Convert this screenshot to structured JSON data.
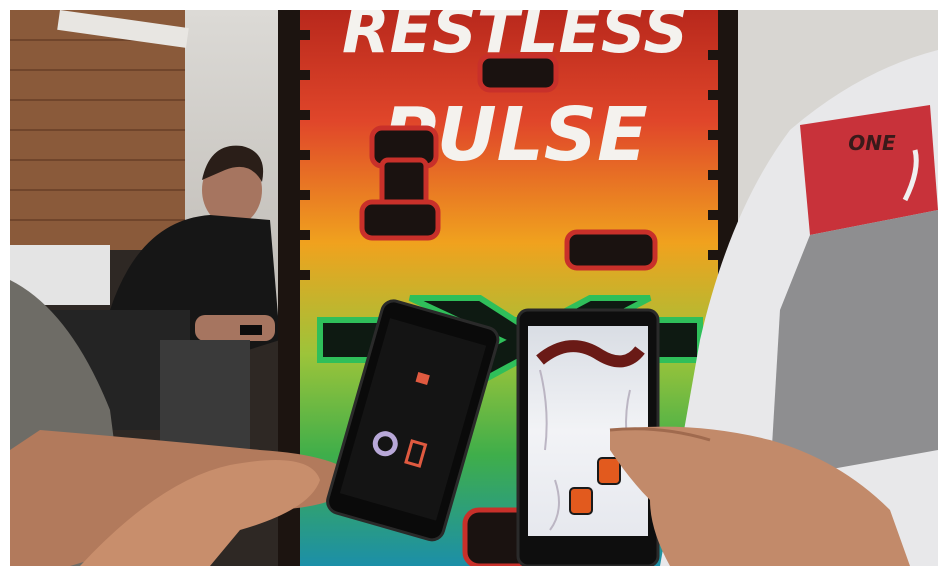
{
  "poster": {
    "title_line1": "RESTLESS",
    "title_line2": "PULSE"
  },
  "jacket_logo": "ONE",
  "colors": {
    "poster_top": "#e0462a",
    "poster_mid": "#f0a21e",
    "poster_low": "#5fbf3a",
    "poster_bottom": "#1c8fa8",
    "jacket_red": "#c8323a",
    "jacket_grey": "#8e8e90",
    "brick": "#8a5a3a"
  }
}
